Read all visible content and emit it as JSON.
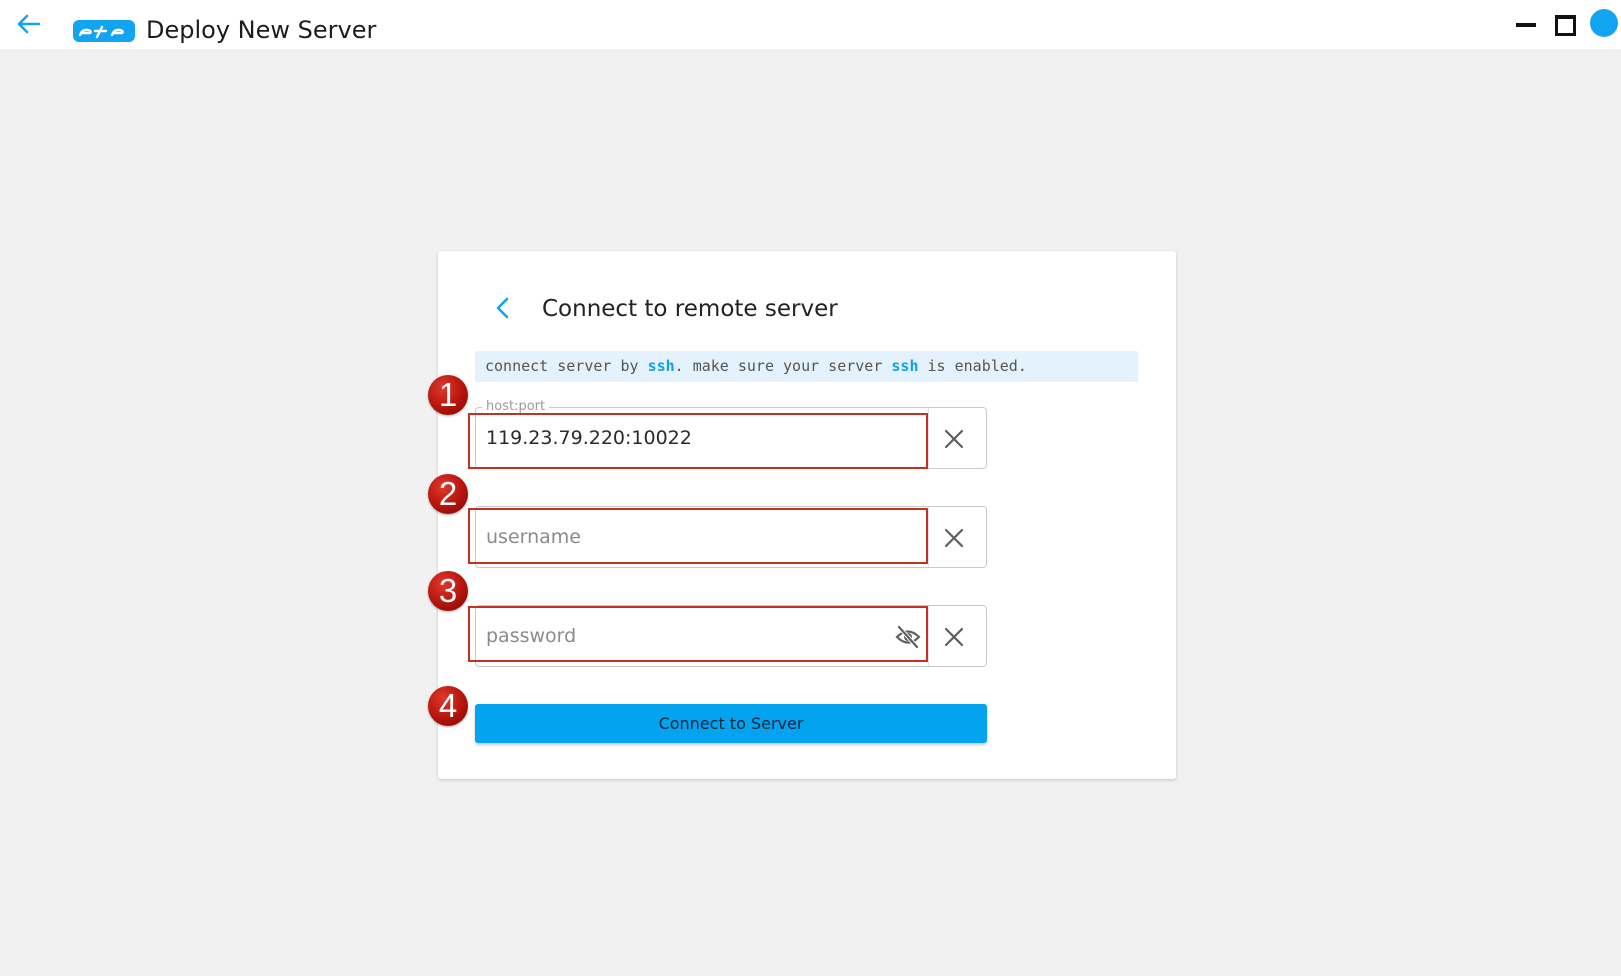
{
  "titlebar": {
    "title": "Deploy New Server",
    "logo_text": "ete",
    "back_icon": "arrow-left-icon",
    "window_controls": [
      "minimize-icon",
      "maximize-icon",
      "status-dot-icon"
    ],
    "accent_color": "#13a4f1"
  },
  "card": {
    "title": "Connect to remote server",
    "back_icon": "chevron-left-icon",
    "hint": {
      "part1": "connect server by ",
      "kw1": "ssh",
      "part2": ". make sure your server ",
      "kw2": "ssh",
      "part3": " is enabled."
    },
    "host_field": {
      "legend": "host:port",
      "value": "119.23.79.220:10022",
      "clear_icon": "close-icon"
    },
    "username_field": {
      "placeholder": "username",
      "value": "",
      "clear_icon": "close-icon"
    },
    "password_field": {
      "placeholder": "password",
      "value": "",
      "visibility_icon": "eye-off-icon",
      "clear_icon": "close-icon"
    },
    "connect_button": "Connect to Server",
    "button_color": "#04a3ef"
  },
  "annotations": {
    "step_1": "1",
    "step_2": "2",
    "step_3": "3",
    "step_4": "4",
    "highlight_color": "#c3321f"
  }
}
